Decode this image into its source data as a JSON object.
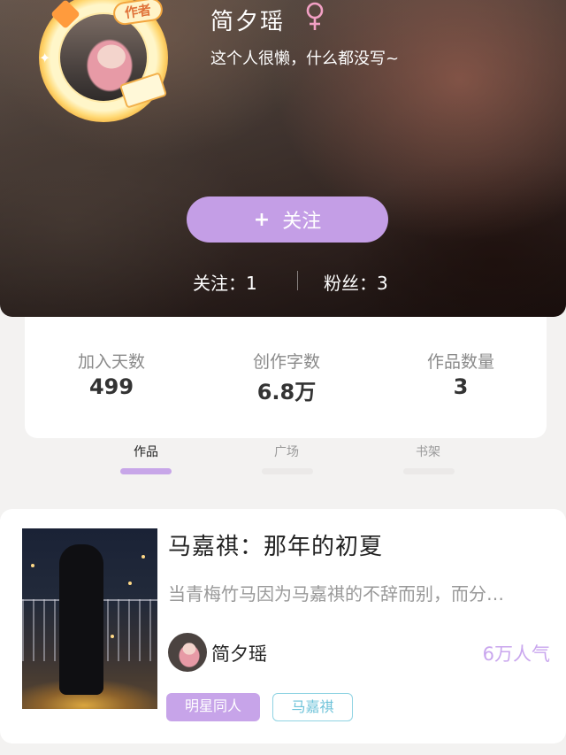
{
  "profile": {
    "name": "简夕瑶",
    "gender_icon": "female-symbol-icon",
    "bio": "这个人很懒，什么都没写~",
    "avatar_badge": "作者",
    "follow_button_plus": "+",
    "follow_button_label": "关注",
    "following": "关注：1",
    "fans": "粉丝：3"
  },
  "stats": [
    {
      "label": "加入天数",
      "value": "499"
    },
    {
      "label": "创作字数",
      "value": "6.8万"
    },
    {
      "label": "作品数量",
      "value": "3"
    }
  ],
  "tabs": [
    {
      "label": "作品",
      "active": true
    },
    {
      "label": "广场",
      "active": false
    },
    {
      "label": "书架",
      "active": false
    }
  ],
  "works": [
    {
      "title": "马嘉祺：那年的初夏",
      "description": "当青梅竹马因为马嘉祺的不辞而别，而分…",
      "author": "简夕瑶",
      "popularity": "6万人气",
      "tags": [
        "明星同人",
        "马嘉祺"
      ]
    }
  ],
  "colors": {
    "accent_purple": "#c49ee6",
    "popularity": "#c9a6ee",
    "tag_cyan": "#6fc3d9"
  }
}
